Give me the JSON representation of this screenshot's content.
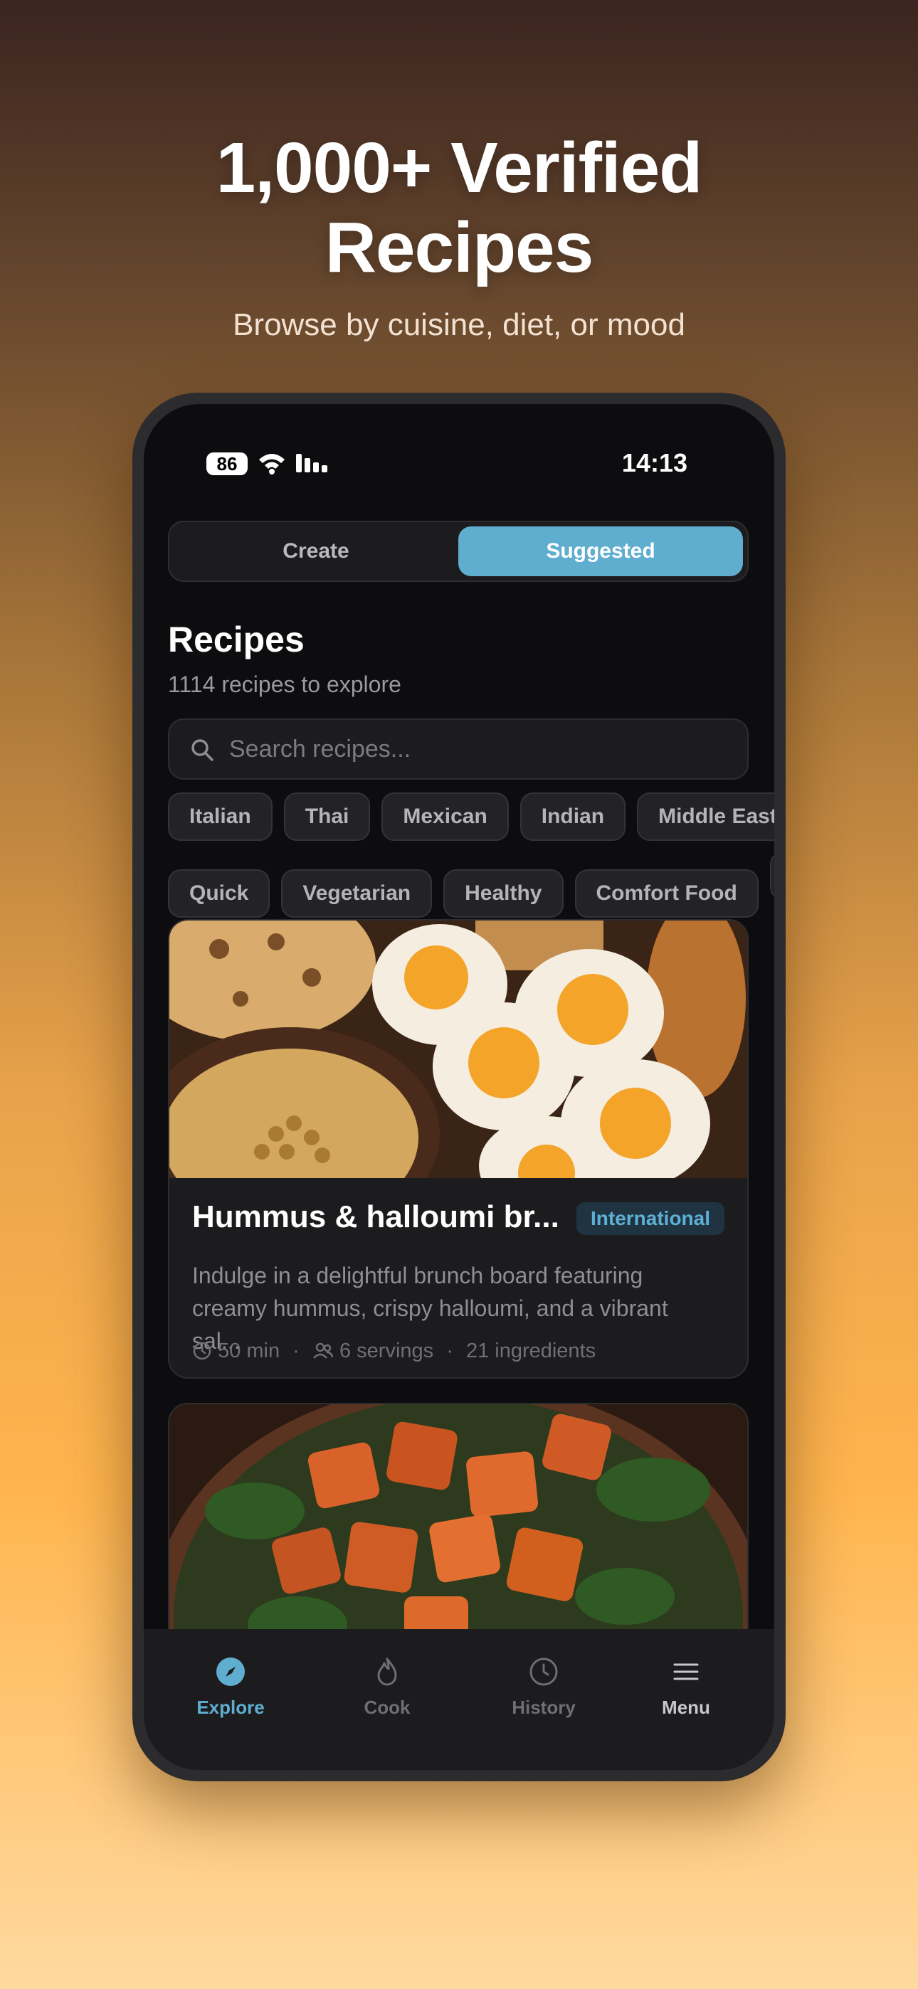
{
  "hero": {
    "title_line1": "1,000+ Verified",
    "title_line2": "Recipes",
    "subtitle": "Browse by cuisine, diet, or mood"
  },
  "status_bar": {
    "battery": "86",
    "time": "14:13"
  },
  "segment": {
    "create": "Create",
    "suggested": "Suggested",
    "selected": "Suggested"
  },
  "section": {
    "title": "Recipes",
    "count": "1114 recipes to explore"
  },
  "search": {
    "placeholder": "Search recipes..."
  },
  "cuisine_filters": [
    "Italian",
    "Thai",
    "Mexican",
    "Indian",
    "Middle East"
  ],
  "mood_filters": [
    "Quick",
    "Vegetarian",
    "Healthy",
    "Comfort Food",
    ""
  ],
  "recipe_card": {
    "title": "Hummus & halloumi br...",
    "badge": "International",
    "description": "Indulge in a delightful brunch board featuring creamy hummus, crispy halloumi, and a vibrant sal...",
    "time": "50 min",
    "servings": "6 servings",
    "ingredients": "21 ingredients",
    "separator": "·"
  },
  "tabbar": {
    "explore": "Explore",
    "cook": "Cook",
    "history": "History",
    "menu": "Menu",
    "active": "Explore"
  },
  "colors": {
    "accent": "#5faed0",
    "background": "#0d0d0f",
    "card": "#1c1c1e"
  }
}
